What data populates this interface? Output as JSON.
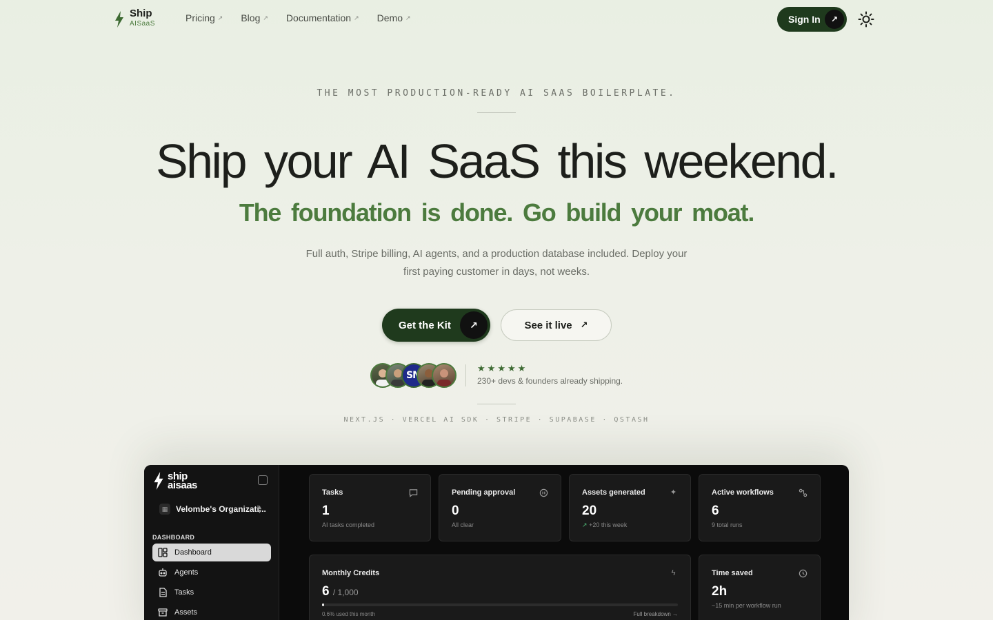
{
  "nav": {
    "logo_name": "Ship",
    "logo_sub": "AISaaS",
    "links": [
      {
        "label": "Pricing",
        "icon": "external-arrow-icon"
      },
      {
        "label": "Blog",
        "icon": "external-arrow-icon"
      },
      {
        "label": "Documentation",
        "icon": "external-arrow-icon"
      },
      {
        "label": "Demo",
        "icon": "external-arrow-icon"
      }
    ],
    "signin_label": "Sign In",
    "theme_icon": "sun-icon"
  },
  "hero": {
    "eyebrow": "THE MOST PRODUCTION-READY AI SAAS BOILERPLATE.",
    "headline": "Ship your AI SaaS this weekend.",
    "subhead": "The foundation is done. Go build your moat.",
    "description": "Full auth, Stripe billing, AI agents, and a production database included. Deploy your first paying customer in days, not weeks.",
    "cta_primary": "Get the Kit",
    "cta_secondary": "See it live",
    "proof_text": "230+ devs & founders already shipping.",
    "rating": 5,
    "avatar_initials": "SM",
    "stack": "NEXT.JS · VERCEL AI SDK · STRIPE · SUPABASE · QSTASH"
  },
  "dashboard": {
    "logo_line1": "ship",
    "logo_line2": "aisaas",
    "org_name": "Velombe's Organizati...",
    "section_label": "DASHBOARD",
    "sidebar": [
      {
        "label": "Dashboard",
        "icon": "layout-icon",
        "active": true
      },
      {
        "label": "Agents",
        "icon": "bot-icon",
        "active": false
      },
      {
        "label": "Tasks",
        "icon": "document-icon",
        "active": false
      },
      {
        "label": "Assets",
        "icon": "archive-icon",
        "active": false
      }
    ],
    "cards": {
      "tasks": {
        "title": "Tasks",
        "value": "1",
        "sub": "AI tasks completed",
        "icon": "message-icon"
      },
      "pending": {
        "title": "Pending approval",
        "value": "0",
        "sub": "All clear",
        "icon": "pause-icon"
      },
      "assets": {
        "title": "Assets generated",
        "value": "20",
        "sub": "+20 this week",
        "icon": "sparkle-icon"
      },
      "workflows": {
        "title": "Active workflows",
        "value": "6",
        "sub": "9 total runs",
        "icon": "workflow-icon"
      },
      "credits": {
        "title": "Monthly Credits",
        "value": "6",
        "total": "/ 1,000",
        "used_fraction": 0.006,
        "foot": "0.6% used this month",
        "link": "Full breakdown →",
        "icon": "zap-icon"
      },
      "time": {
        "title": "Time saved",
        "value": "2h",
        "sub": "~15 min per workflow run",
        "icon": "clock-icon"
      }
    }
  },
  "colors": {
    "brand_dark": "#1f3a1d",
    "brand_green": "#4c7b3e",
    "trend_green": "#4fbf7a"
  }
}
